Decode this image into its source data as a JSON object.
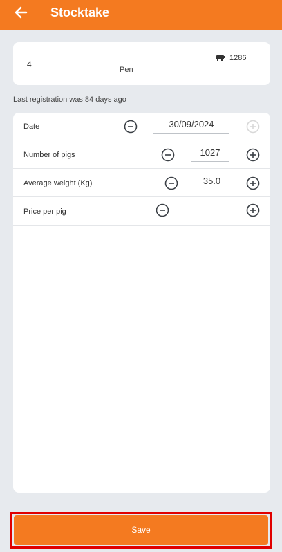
{
  "header": {
    "title": "Stocktake",
    "back_icon": "arrow-left-icon"
  },
  "pen": {
    "number": "4",
    "label": "Pen",
    "pig_count": "1286",
    "pig_icon": "pig-icon"
  },
  "last_registration": "Last registration was 84 days ago",
  "form": {
    "date": {
      "label": "Date",
      "value": "30/09/2024"
    },
    "number_of_pigs": {
      "label": "Number of pigs",
      "value": "1027"
    },
    "average_weight": {
      "label": "Average weight (Kg)",
      "value": "35.0"
    },
    "price_per_pig": {
      "label": "Price per pig",
      "value": ""
    }
  },
  "save_label": "Save",
  "colors": {
    "accent": "#f47a20",
    "background": "#e7eaee",
    "highlight_border": "#e00000",
    "disabled": "#d8d8d8"
  }
}
